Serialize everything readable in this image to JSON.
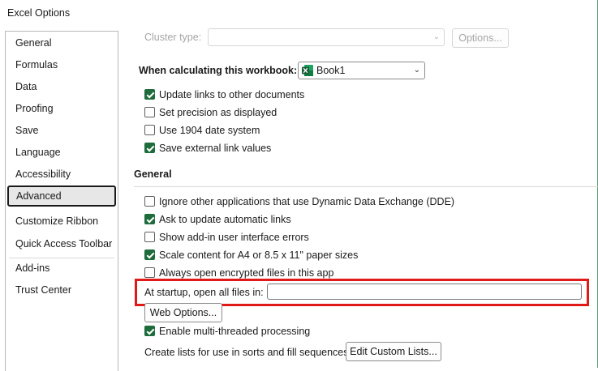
{
  "window": {
    "title": "Excel Options"
  },
  "sidebar": {
    "items": [
      {
        "label": "General"
      },
      {
        "label": "Formulas"
      },
      {
        "label": "Data"
      },
      {
        "label": "Proofing"
      },
      {
        "label": "Save"
      },
      {
        "label": "Language"
      },
      {
        "label": "Accessibility"
      },
      {
        "label": "Advanced",
        "selected": true
      },
      {
        "label": "Customize Ribbon"
      },
      {
        "label": "Quick Access Toolbar"
      },
      {
        "label": "Add-ins"
      },
      {
        "label": "Trust Center"
      }
    ]
  },
  "top": {
    "cluster_type_label": "Cluster type:",
    "cluster_type_value": "",
    "options_button": "Options..."
  },
  "workbook": {
    "label": "When calculating this workbook:",
    "selected": "Book1",
    "options": [
      {
        "label": "Update links to other documents",
        "checked": true
      },
      {
        "label": "Set precision as displayed",
        "checked": false
      },
      {
        "label": "Use 1904 date system",
        "checked": false
      },
      {
        "label": "Save external link values",
        "checked": true
      }
    ]
  },
  "general": {
    "heading": "General",
    "options": [
      {
        "label": "Ignore other applications that use Dynamic Data Exchange (DDE)",
        "checked": false
      },
      {
        "label": "Ask to update automatic links",
        "checked": true
      },
      {
        "label": "Show add-in user interface errors",
        "checked": false
      },
      {
        "label": "Scale content for A4 or 8.5 x 11\" paper sizes",
        "checked": true
      },
      {
        "label": "Always open encrypted files in this app",
        "checked": false
      }
    ],
    "startup_label": "At startup, open all files in:",
    "startup_value": "",
    "web_options_button": "Web Options...",
    "multithreaded_label": "Enable multi-threaded processing",
    "multithreaded_checked": true,
    "custom_lists_label": "Create lists for use in sorts and fill sequences:",
    "custom_lists_button": "Edit Custom Lists..."
  },
  "colors": {
    "accent": "#1e6b3c",
    "highlight": "#e01919"
  }
}
